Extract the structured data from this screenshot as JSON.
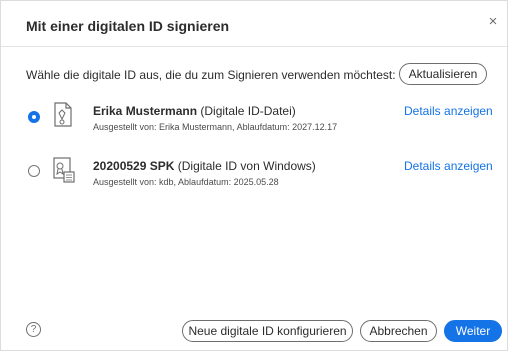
{
  "dialog": {
    "title": "Mit einer digitalen ID signieren",
    "close_glyph": "×",
    "prompt": "Wähle die digitale ID aus, die du zum Signieren verwenden möchtest:",
    "refresh_label": "Aktualisieren"
  },
  "ids": [
    {
      "name": "Erika Mustermann",
      "type": "(Digitale ID-Datei)",
      "issued": "Ausgestellt von: Erika Mustermann, Ablaufdatum: 2027.12.17",
      "details_label": "Details anzeigen",
      "selected": true,
      "icon": "certificate-file-icon"
    },
    {
      "name": "20200529 SPK",
      "type": "(Digitale ID von Windows)",
      "issued": "Ausgestellt von: kdb, Ablaufdatum: 2025.05.28",
      "details_label": "Details anzeigen",
      "selected": false,
      "icon": "certificate-windows-icon"
    }
  ],
  "footer": {
    "help_glyph": "?",
    "new_id_label": "Neue digitale ID konfigurieren",
    "cancel_label": "Abbrechen",
    "next_label": "Weiter"
  },
  "colors": {
    "accent": "#1473e6",
    "text": "#2c2c2c",
    "border": "#6e6e6e"
  }
}
